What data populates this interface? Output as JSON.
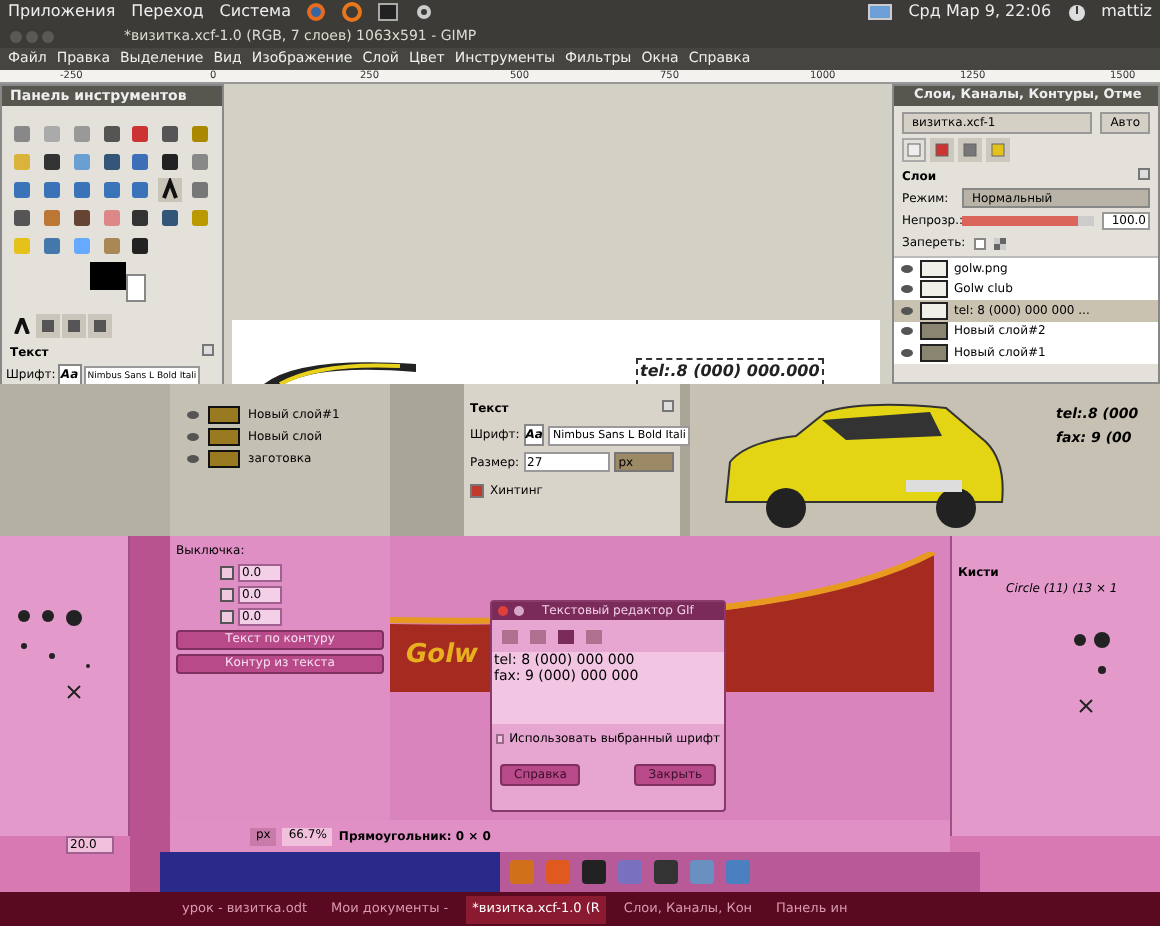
{
  "top_panel": {
    "menus": [
      "Приложения",
      "Переход",
      "Система"
    ],
    "clock": "Срд Мар  9, 22:06",
    "user": "mattiz"
  },
  "window": {
    "title": "*визитка.xcf-1.0 (RGB, 7 слоев) 1063x591 - GIMP"
  },
  "menu_bar": [
    "Файл",
    "Правка",
    "Выделение",
    "Вид",
    "Изображение",
    "Слой",
    "Цвет",
    "Инструменты",
    "Фильтры",
    "Окна",
    "Справка"
  ],
  "ruler": [
    "-250",
    "0",
    "250",
    "500",
    "750",
    "1000",
    "1250",
    "1500"
  ],
  "toolbox": {
    "title": "Панель инструментов",
    "tabs": [
      {
        "selected": true
      },
      {
        "selected": false
      },
      {
        "selected": false
      },
      {
        "selected": false
      }
    ],
    "section": "Текст",
    "font_label": "Шрифт:",
    "font_preview": "Aa",
    "font": "Nimbus Sans L Bold Itali"
  },
  "layers_dock": {
    "title": "Слои, Каналы, Контуры, Отме",
    "image": "визитка.xcf-1",
    "auto": "Авто",
    "tabs": [
      {
        "selected": true
      },
      {
        "selected": false
      },
      {
        "selected": false
      },
      {
        "selected": false
      }
    ],
    "section": "Слои",
    "mode_label": "Режим:",
    "mode": "Нормальный",
    "opacity_label": "Непрозр.:",
    "opacity": {
      "level": 0.88
    },
    "opacity_value": "100.0",
    "lock_label": "Запереть:",
    "lock_checked": false,
    "layers": [
      {
        "name": "golw.png",
        "selected": false
      },
      {
        "name": "Golw club",
        "selected": false
      },
      {
        "name": "tel: 8 (000) 000 000 ...",
        "selected": true
      },
      {
        "name": "Новый слой#2",
        "selected": false
      },
      {
        "name": "Новый слой#1",
        "selected": false
      }
    ]
  },
  "canvas": {
    "text": "tel:.8 (000) 000.000"
  },
  "glitch_band": {
    "layers": [
      {
        "name": "Новый слой#1"
      },
      {
        "name": "Новый слой"
      },
      {
        "name": "заготовка"
      }
    ],
    "text_options": {
      "section": "Текст",
      "font_label": "Шрифт:",
      "font_preview": "Aa",
      "font": "Nimbus Sans L Bold Itali",
      "size_label": "Размер:",
      "size": "27",
      "unit": "px",
      "hinting": {
        "label": "Хинтинг",
        "checked": true
      }
    },
    "canvas_lines": [
      "tel:.8 (000",
      "fax: 9 (00"
    ]
  },
  "pink_band": {
    "justify_label": "Выключка:",
    "spin_values": [
      "0.0",
      "0.0",
      "0.0"
    ],
    "buttons": [
      "Текст по контуру",
      "Контур из текста"
    ],
    "banner_text": "Golw",
    "left_value": "20.0",
    "brushes": {
      "title": "Кисти",
      "brush": "Circle (11) (13 × 1"
    },
    "dialog": {
      "title": "Текстовый редактор GIf",
      "lines": [
        "tel: 8 (000) 000 000",
        "fax: 9 (000) 000 000"
      ],
      "checkbox": {
        "label": "Использовать выбранный шрифт",
        "checked": false
      },
      "buttons": [
        "Справка",
        "Закрыть"
      ]
    },
    "status": {
      "unit": "px",
      "zoom": "66.7%",
      "info": "Прямоугольник: 0 × 0"
    }
  },
  "taskbar": [
    {
      "label": "урок - визитка.odt",
      "selected": false
    },
    {
      "label": "Мои документы -",
      "selected": false
    },
    {
      "label": "*визитка.xcf-1.0 (R",
      "selected": true
    },
    {
      "label": "Слои, Каналы, Кон",
      "selected": false
    },
    {
      "label": "Панель ин",
      "selected": false
    }
  ]
}
